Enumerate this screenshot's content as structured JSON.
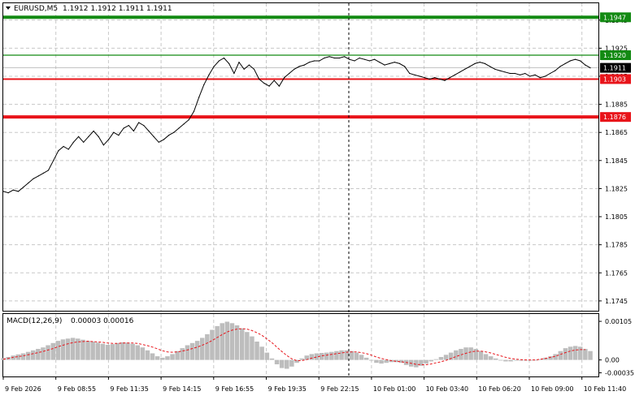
{
  "header": {
    "symbol_label": "EURUSD,M5",
    "ohlc_label": "1.1912 1.1912 1.1911 1.1911"
  },
  "macd": {
    "label": "MACD(12,26,9)",
    "values_label": "0.00003 0.00016"
  },
  "colors": {
    "background": "#ffffff",
    "price_line": "#000000",
    "grid": "#c8c8c8",
    "green_level": "#138a13",
    "red_level": "#e8141a",
    "current_price_tag": "#000000",
    "macd_hist": "#bdbdbd",
    "macd_signal": "#e8141a"
  },
  "chart_data": [
    {
      "type": "line",
      "symbol": "EURUSD",
      "timeframe": "M5",
      "y_axis": {
        "range": [
          1.1738,
          1.1957
        ],
        "tick_labels": [
          "1.1945",
          "1.1925",
          "1.1905",
          "1.1885",
          "1.1865",
          "1.1845",
          "1.1825",
          "1.1805",
          "1.1785",
          "1.1765",
          "1.1745"
        ]
      },
      "x_axis": {
        "tick_labels": [
          "9 Feb 2026",
          "9 Feb 08:55",
          "9 Feb 11:35",
          "9 Feb 14:15",
          "9 Feb 16:55",
          "9 Feb 19:35",
          "9 Feb 22:15",
          "10 Feb 01:00",
          "10 Feb 03:40",
          "10 Feb 06:20",
          "10 Feb 09:00",
          "10 Feb 11:40"
        ]
      },
      "grid": true,
      "current_price": "1.1911",
      "levels": [
        {
          "value": "1.1947",
          "color": "#138a13",
          "style": "thick"
        },
        {
          "value": "1.1920",
          "color": "#138a13",
          "style": "thin"
        },
        {
          "value": "1.1903",
          "color": "#e8141a",
          "style": "medium"
        },
        {
          "value": "1.1876",
          "color": "#e8141a",
          "style": "thick"
        }
      ],
      "x": [
        "9 Feb 2026",
        "",
        "",
        "",
        "",
        "",
        "",
        "",
        "",
        "",
        "",
        "",
        "",
        "",
        "",
        "",
        "",
        "",
        "",
        "",
        "",
        "",
        "",
        "",
        "",
        "",
        "",
        "",
        "",
        "",
        "",
        "",
        "",
        "",
        "",
        "",
        "",
        "",
        "",
        "",
        "",
        "",
        "",
        "",
        "",
        "",
        "",
        "",
        "",
        "",
        "",
        "",
        "",
        "",
        "",
        "",
        "",
        "",
        "",
        "",
        "",
        "",
        "",
        "",
        "",
        "",
        "",
        "",
        "",
        "",
        "",
        "",
        "",
        "",
        "",
        "",
        "",
        "",
        "",
        "",
        "",
        "",
        "",
        "",
        "",
        "",
        "",
        "",
        "",
        "",
        "",
        "",
        "",
        "",
        "",
        "",
        "",
        "",
        "",
        "",
        "",
        "",
        "",
        "",
        "",
        "",
        "",
        "",
        "",
        "",
        "",
        "",
        "",
        "",
        "",
        "",
        "10 Feb 11:40"
      ],
      "values": [
        1.1823,
        1.1822,
        1.1824,
        1.1823,
        1.1826,
        1.1829,
        1.1832,
        1.1834,
        1.1836,
        1.1838,
        1.1845,
        1.1852,
        1.1855,
        1.1853,
        1.1858,
        1.1862,
        1.1858,
        1.1862,
        1.1866,
        1.1862,
        1.1856,
        1.186,
        1.1865,
        1.1863,
        1.1868,
        1.187,
        1.1866,
        1.1872,
        1.187,
        1.1866,
        1.1862,
        1.1858,
        1.186,
        1.1863,
        1.1865,
        1.1868,
        1.1871,
        1.1874,
        1.188,
        1.189,
        1.1899,
        1.1906,
        1.1912,
        1.1916,
        1.1918,
        1.1914,
        1.1907,
        1.1915,
        1.191,
        1.1913,
        1.191,
        1.1903,
        1.19,
        1.1898,
        1.1902,
        1.1898,
        1.1904,
        1.1907,
        1.191,
        1.1912,
        1.1913,
        1.1915,
        1.1916,
        1.1916,
        1.1918,
        1.1919,
        1.1918,
        1.1918,
        1.1919,
        1.1917,
        1.1916,
        1.1918,
        1.1917,
        1.1916,
        1.1917,
        1.1915,
        1.1913,
        1.1914,
        1.1915,
        1.1914,
        1.1912,
        1.1907,
        1.1906,
        1.1905,
        1.1904,
        1.1903,
        1.1904,
        1.1903,
        1.1902,
        1.1904,
        1.1906,
        1.1908,
        1.191,
        1.1912,
        1.1914,
        1.1915,
        1.1914,
        1.1912,
        1.191,
        1.1909,
        1.1908,
        1.1907,
        1.1907,
        1.1906,
        1.1907,
        1.1905,
        1.1906,
        1.1904,
        1.1905,
        1.1907,
        1.1909,
        1.1912,
        1.1914,
        1.1916,
        1.1917,
        1.1916,
        1.1913,
        1.1911
      ]
    },
    {
      "type": "bar",
      "name": "MACD(12,26,9)",
      "y_axis": {
        "tick_labels": [
          "0.00105",
          "0.00",
          "-0.00035"
        ],
        "range": [
          -0.00045,
          0.00125
        ]
      },
      "x": [
        "9 Feb 2026",
        "",
        "",
        "",
        "",
        "",
        "",
        "",
        "",
        "",
        "",
        "",
        "",
        "",
        "",
        "",
        "",
        "",
        "",
        "",
        "",
        "",
        "",
        "",
        "",
        "",
        "",
        "",
        "",
        "",
        "",
        "",
        "",
        "",
        "",
        "",
        "",
        "",
        "",
        "",
        "",
        "",
        "",
        "",
        "",
        "",
        "",
        "",
        "",
        "",
        "",
        "",
        "",
        "",
        "",
        "",
        "",
        "",
        "",
        "",
        "",
        "",
        "",
        "",
        "",
        "",
        "",
        "",
        "",
        "",
        "",
        "",
        "",
        "",
        "",
        "",
        "",
        "",
        "",
        "",
        "",
        "",
        "",
        "",
        "",
        "",
        "",
        "",
        "",
        "",
        "",
        "",
        "",
        "",
        "",
        "",
        "",
        "",
        "",
        "",
        "",
        "",
        "",
        "",
        "",
        "",
        "",
        "",
        "",
        "",
        "",
        "",
        "",
        "",
        "",
        "",
        "10 Feb 11:40"
      ],
      "values": [
        5e-05,
        8e-05,
        0.00012,
        0.00015,
        0.00018,
        0.00022,
        0.00026,
        0.0003,
        0.00034,
        0.0004,
        0.00046,
        0.00052,
        0.00056,
        0.00058,
        0.0006,
        0.00058,
        0.00055,
        0.00052,
        0.0005,
        0.00047,
        0.00044,
        0.00041,
        0.00043,
        0.00046,
        0.00048,
        0.00047,
        0.00044,
        0.0004,
        0.00034,
        0.00026,
        0.00018,
        0.0001,
        6e-05,
        0.0001,
        0.00016,
        0.00024,
        0.00032,
        0.0004,
        0.00046,
        0.00052,
        0.0006,
        0.0007,
        0.00082,
        0.00092,
        0.001,
        0.00104,
        0.001,
        0.00094,
        0.00086,
        0.00076,
        0.00064,
        0.0005,
        0.00036,
        0.0002,
        4e-05,
        -0.00012,
        -0.00022,
        -0.00024,
        -0.00018,
        -8e-05,
        4e-05,
        0.00012,
        0.00016,
        0.00018,
        0.00019,
        0.0002,
        0.00022,
        0.00024,
        0.00026,
        0.00026,
        0.00024,
        0.0002,
        0.00014,
        6e-05,
        -2e-05,
        -8e-05,
        -0.0001,
        -8e-05,
        -6e-05,
        -6e-05,
        -8e-05,
        -0.00014,
        -0.00018,
        -0.0002,
        -0.00016,
        -0.0001,
        -4e-05,
        2e-05,
        8e-05,
        0.00014,
        0.0002,
        0.00026,
        0.0003,
        0.00034,
        0.00034,
        0.0003,
        0.00024,
        0.00016,
        0.0001,
        4e-05,
        0.0,
        -4e-05,
        -4e-05,
        -2e-05,
        -2e-05,
        -2e-05,
        -2e-05,
        0.0,
        2e-05,
        6e-05,
        0.0001,
        0.00016,
        0.00024,
        0.00032,
        0.00036,
        0.00038,
        0.00036,
        0.0003,
        0.00024
      ],
      "signal": [
        2e-05,
        4e-05,
        7e-05,
        9e-05,
        0.00011,
        0.00014,
        0.00017,
        0.0002,
        0.00023,
        0.00027,
        0.00031,
        0.00036,
        0.0004,
        0.00044,
        0.00047,
        0.00049,
        0.0005,
        0.00051,
        0.0005,
        0.00049,
        0.00048,
        0.00046,
        0.00045,
        0.00045,
        0.00046,
        0.00046,
        0.00046,
        0.00045,
        0.00042,
        0.00039,
        0.00035,
        0.0003,
        0.00025,
        0.00022,
        0.00021,
        0.00022,
        0.00024,
        0.00027,
        0.00031,
        0.00035,
        0.0004,
        0.00046,
        0.00053,
        0.00061,
        0.00069,
        0.00076,
        0.00081,
        0.00084,
        0.00085,
        0.00084,
        0.0008,
        0.00074,
        0.00067,
        0.00057,
        0.00047,
        0.00035,
        0.00023,
        0.00012,
        3e-05,
        -2e-05,
        -2e-05,
        1e-05,
        5e-05,
        8e-05,
        0.00011,
        0.00013,
        0.00015,
        0.00017,
        0.00019,
        0.00021,
        0.00022,
        0.00022,
        0.0002,
        0.00017,
        0.00013,
        8e-05,
        4e-05,
        1e-05,
        -2e-05,
        -4e-05,
        -5e-05,
        -7e-05,
        -9e-05,
        -0.00012,
        -0.00013,
        -0.00013,
        -0.00011,
        -8e-05,
        -5e-05,
        -1e-05,
        4e-05,
        9e-05,
        0.00014,
        0.00018,
        0.00022,
        0.00024,
        0.00024,
        0.00022,
        0.00019,
        0.00015,
        0.00011,
        7e-05,
        4e-05,
        2e-05,
        1e-05,
        0.0,
        0.0,
        0.0,
        2e-05,
        4e-05,
        7e-05,
        0.0001,
        0.00015,
        0.0002,
        0.00024,
        0.00027,
        0.00028,
        0.00028
      ]
    }
  ]
}
